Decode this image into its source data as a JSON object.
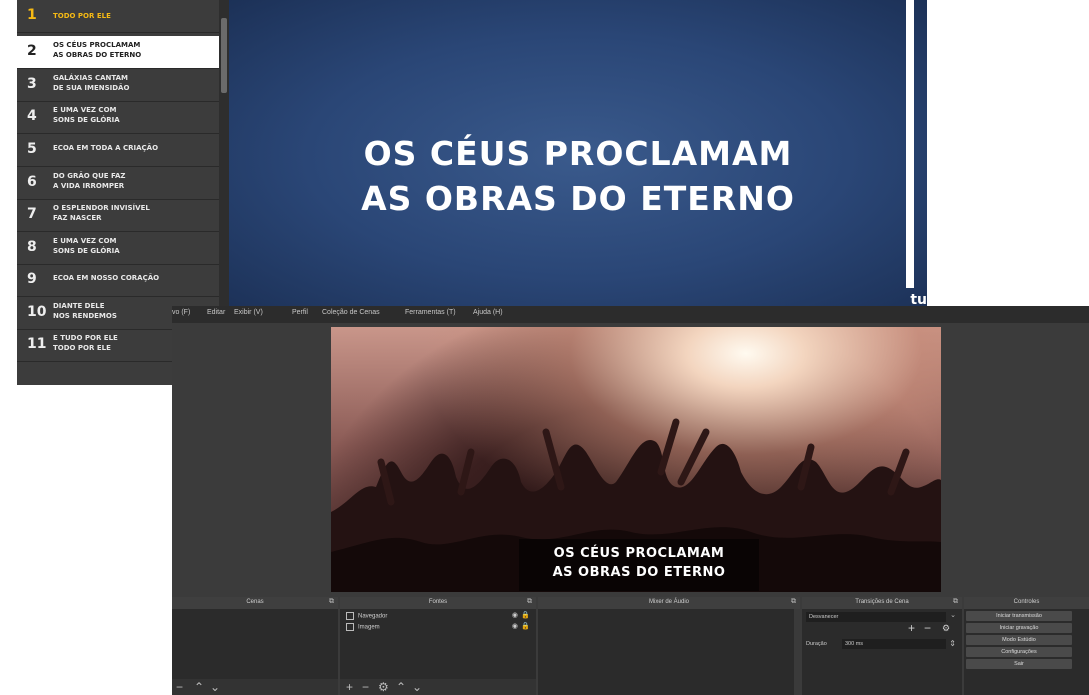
{
  "lyrics": [
    {
      "num": "1",
      "text": "TODO POR ELE"
    },
    {
      "num": "2",
      "text": "OS CÉUS PROCLAMAM\nAS OBRAS DO ETERNO"
    },
    {
      "num": "3",
      "text": "GALÁXIAS CANTAM\nDE SUA IMENSIDÃO"
    },
    {
      "num": "4",
      "text": "E UMA VEZ COM\nSONS DE GLÓRIA"
    },
    {
      "num": "5",
      "text": "ECOA EM TODA A CRIAÇÃO"
    },
    {
      "num": "6",
      "text": "DO GRÃO QUE FAZ\nA VIDA IRROMPER"
    },
    {
      "num": "7",
      "text": "O ESPLENDOR INVISÍVEL\nFAZ NASCER"
    },
    {
      "num": "8",
      "text": "E UMA VEZ COM\nSONS DE GLÓRIA"
    },
    {
      "num": "9",
      "text": "ECOA EM NOSSO CORAÇÃO"
    },
    {
      "num": "10",
      "text": "DIANTE DELE\nNOS RENDEMOS"
    },
    {
      "num": "11",
      "text": "E TUDO POR ELE\nTODO POR ELE"
    }
  ],
  "slide": {
    "line1": "OS CÉUS PROCLAMAM",
    "line2": "AS OBRAS DO ETERNO",
    "logo": "tu"
  },
  "obs": {
    "menu": [
      "vo (F)",
      "Editar",
      "Exibir (V)",
      "Perfil",
      "Coleção de Cenas",
      "Ferramentas (T)",
      "Ajuda (H)"
    ],
    "preview_line1": "OS CÉUS PROCLAMAM",
    "preview_line2": "AS OBRAS DO ETERNO",
    "docks": {
      "scenes": "Cenas",
      "sources": "Fontes",
      "mixer": "Mixer de Áudio",
      "transitions": "Transições de Cena",
      "controls": "Controles"
    },
    "sources_list": [
      "Navegador",
      "Imagem"
    ],
    "transition": {
      "type": "Desvanecer",
      "duration_label": "Duração",
      "duration_value": "300 ms"
    },
    "controls": [
      "Iniciar transmissão",
      "Iniciar gravação",
      "Modo Estúdio",
      "Configurações",
      "Sair"
    ]
  }
}
